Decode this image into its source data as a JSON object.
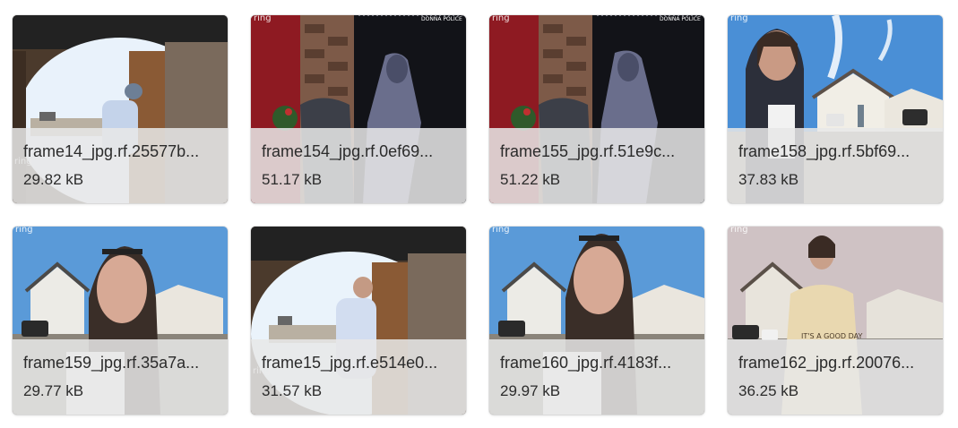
{
  "cards": [
    {
      "name": "frame14_jpg.rf.25577b...",
      "size": "29.82 kB",
      "scene": "peephole-man"
    },
    {
      "name": "frame154_jpg.rf.0ef69...",
      "size": "51.17 kB",
      "scene": "hooded-night"
    },
    {
      "name": "frame155_jpg.rf.51e9c...",
      "size": "51.22 kB",
      "scene": "hooded-night"
    },
    {
      "name": "frame158_jpg.rf.5bf69...",
      "size": "37.83 kB",
      "scene": "woman-blue-sky"
    },
    {
      "name": "frame159_jpg.rf.35a7a...",
      "size": "29.77 kB",
      "scene": "woman-close"
    },
    {
      "name": "frame15_jpg.rf.e514e0...",
      "size": "31.57 kB",
      "scene": "peephole-man"
    },
    {
      "name": "frame160_jpg.rf.4183f...",
      "size": "29.97 kB",
      "scene": "woman-close"
    },
    {
      "name": "frame162_jpg.rf.20076...",
      "size": "36.25 kB",
      "scene": "woman-overcast"
    }
  ],
  "colors": {
    "caption_bg": "#e8e8e8",
    "text": "#2b2b2b"
  },
  "watermark": "ring"
}
